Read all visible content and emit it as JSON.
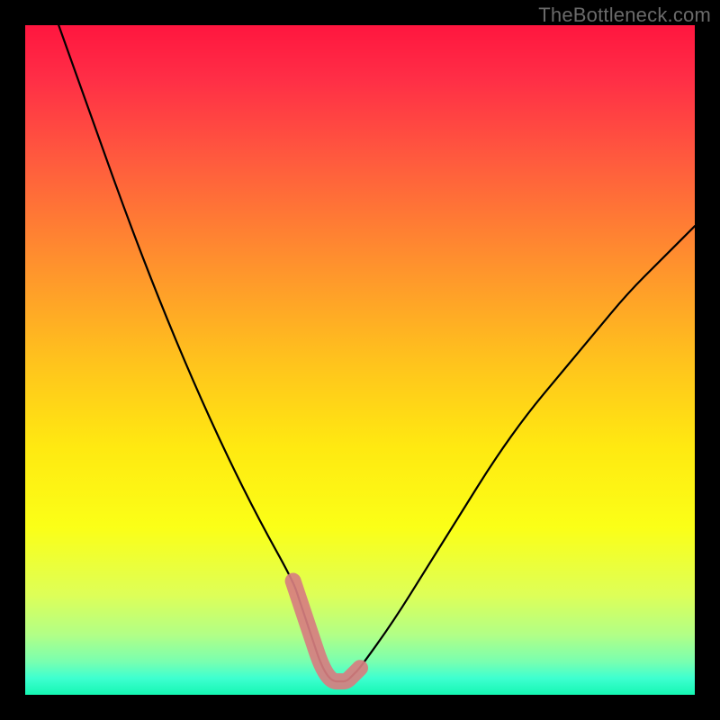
{
  "watermark": "TheBottleneck.com",
  "chart_data": {
    "type": "line",
    "title": "",
    "xlabel": "",
    "ylabel": "",
    "xlim": [
      0,
      100
    ],
    "ylim": [
      0,
      100
    ],
    "series": [
      {
        "name": "bottleneck-curve",
        "x": [
          5,
          10,
          15,
          20,
          25,
          30,
          35,
          40,
          41,
          42,
          43,
          44,
          45,
          46,
          47,
          48,
          49,
          50,
          55,
          60,
          65,
          70,
          75,
          80,
          85,
          90,
          95,
          100
        ],
        "values": [
          100,
          86,
          72,
          59,
          47,
          36,
          26,
          17,
          14,
          11,
          8,
          5,
          3,
          2,
          2,
          2,
          3,
          4,
          11,
          19,
          27,
          35,
          42,
          48,
          54,
          60,
          65,
          70
        ]
      }
    ],
    "highlight": {
      "name": "optimal-band",
      "color": "#d77e80",
      "x": [
        40,
        41,
        42,
        43,
        44,
        45,
        46,
        47,
        48,
        49,
        50
      ],
      "values": [
        17,
        14,
        11,
        8,
        5,
        3,
        2,
        2,
        2,
        3,
        4
      ]
    },
    "background_gradient_stops": [
      {
        "offset": 0.0,
        "color": "#ff163f"
      },
      {
        "offset": 0.08,
        "color": "#ff2e46"
      },
      {
        "offset": 0.2,
        "color": "#ff5a3e"
      },
      {
        "offset": 0.35,
        "color": "#ff8f2e"
      },
      {
        "offset": 0.5,
        "color": "#ffc21d"
      },
      {
        "offset": 0.63,
        "color": "#ffe911"
      },
      {
        "offset": 0.75,
        "color": "#fbff17"
      },
      {
        "offset": 0.85,
        "color": "#deff57"
      },
      {
        "offset": 0.91,
        "color": "#b2ff86"
      },
      {
        "offset": 0.95,
        "color": "#7affaf"
      },
      {
        "offset": 0.975,
        "color": "#3effd0"
      },
      {
        "offset": 1.0,
        "color": "#15f7b3"
      }
    ]
  }
}
